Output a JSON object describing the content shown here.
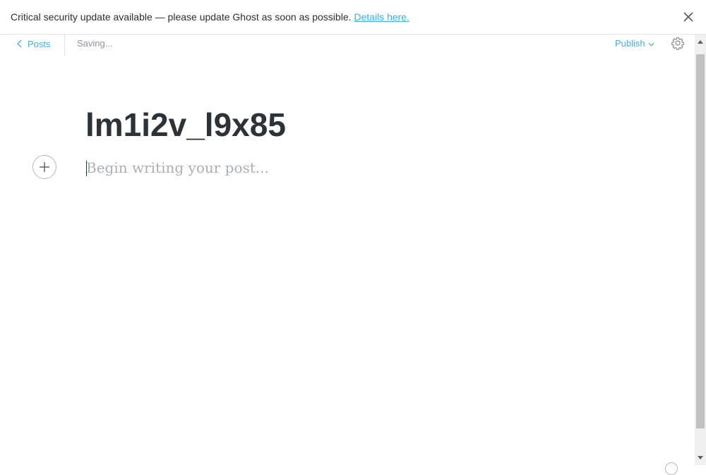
{
  "banner": {
    "message": "Critical security update available — please update Ghost as soon as possible.",
    "link_label": "Details here.",
    "close_icon": "close-icon"
  },
  "header": {
    "back_label": "Posts",
    "back_icon": "chevron-left-icon",
    "status": "Saving...",
    "publish_label": "Publish",
    "publish_icon": "chevron-down-icon",
    "settings_icon": "gear-icon"
  },
  "editor": {
    "title": "lm1i2v_l9x85",
    "body_placeholder": "Begin writing your post...",
    "add_card_icon": "plus-icon"
  },
  "colors": {
    "accent": "#3eb0ef",
    "title_text": "#2b3339",
    "placeholder_text": "#a9b0b5",
    "muted_text": "#8e969c",
    "border": "#e3e6e8"
  }
}
